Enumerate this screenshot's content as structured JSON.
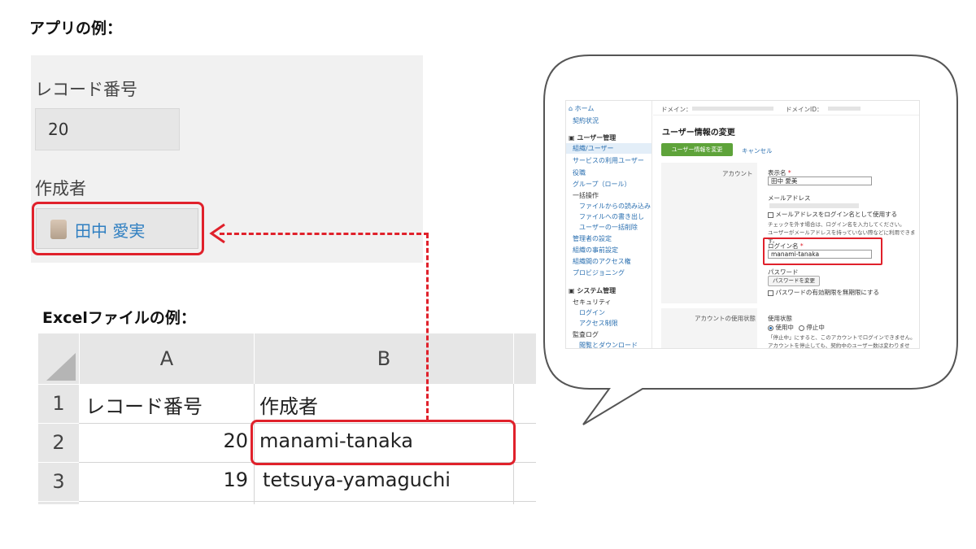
{
  "headings": {
    "app_example": "アプリの例：",
    "excel_example": "Excelファイルの例："
  },
  "app": {
    "record_label": "レコード番号",
    "record_value": "20",
    "creator_label": "作成者",
    "creator_name": "田中 愛実"
  },
  "excel": {
    "col_a": "A",
    "col_b": "B",
    "rows": [
      {
        "num": "1",
        "a": "レコード番号",
        "b": "作成者"
      },
      {
        "num": "2",
        "a": "20",
        "b": "manami-tanaka"
      },
      {
        "num": "3",
        "a": "19",
        "b": "tetsuya-yamaguchi"
      }
    ]
  },
  "admin": {
    "sidebar": {
      "home": "ホーム",
      "contract": "契約状況",
      "user_mgmt": "ユーザー管理",
      "org_user": "組織/ユーザー",
      "service_users": "サービスの利用ユーザー",
      "roles": "役職",
      "groups": "グループ（ロール）",
      "bulk": "一括操作",
      "file_import": "ファイルからの読み込み",
      "file_export": "ファイルへの書き出し",
      "bulk_delete": "ユーザーの一括削除",
      "admin_settings": "管理者の設定",
      "org_prior": "組織の事前設定",
      "org_access": "組織間のアクセス権",
      "provisioning": "プロビジョニング",
      "system_mgmt": "システム管理",
      "security": "セキュリティ",
      "login": "ログイン",
      "access_limit": "アクセス制限",
      "audit_log": "監査ログ",
      "view_download": "閲覧とダウンロード"
    },
    "domain_label": "ドメイン：",
    "domain_id_label": "ドメインID：",
    "page_title": "ユーザー情報の変更",
    "save_button": "ユーザー情報を変更",
    "cancel_link": "キャンセル",
    "account_label": "アカウント",
    "display_name_label": "表示名",
    "required_mark": "*",
    "display_name_value": "田中 愛美",
    "email_label": "メールアドレス",
    "email_as_login": "メールアドレスをログイン名として使用する",
    "email_note_1": "チェックを外す場合は、ログイン名を入力してください。",
    "email_note_2": "ユーザーがメールアドレスを持っていない際などに利用できます。",
    "login_name_label": "ログイン名",
    "login_name_value": "manami-tanaka",
    "password_label": "パスワード",
    "change_password_button": "パスワードを変更",
    "password_no_expiry": "パスワードの有効期限を無期限にする",
    "account_status_label": "アカウントの使用状態",
    "usage_status_label": "使用状態",
    "status_active": "使用中",
    "status_stopped": "停止中",
    "status_note_1": "「停止中」にすると、このアカウントでログインできません。",
    "status_note_2": "アカウントを停止しても、契約中のユーザー数は変わりません。"
  },
  "colors": {
    "highlight": "#e0212b",
    "link": "#2f7fc1",
    "primary_button": "#5ea33a"
  }
}
